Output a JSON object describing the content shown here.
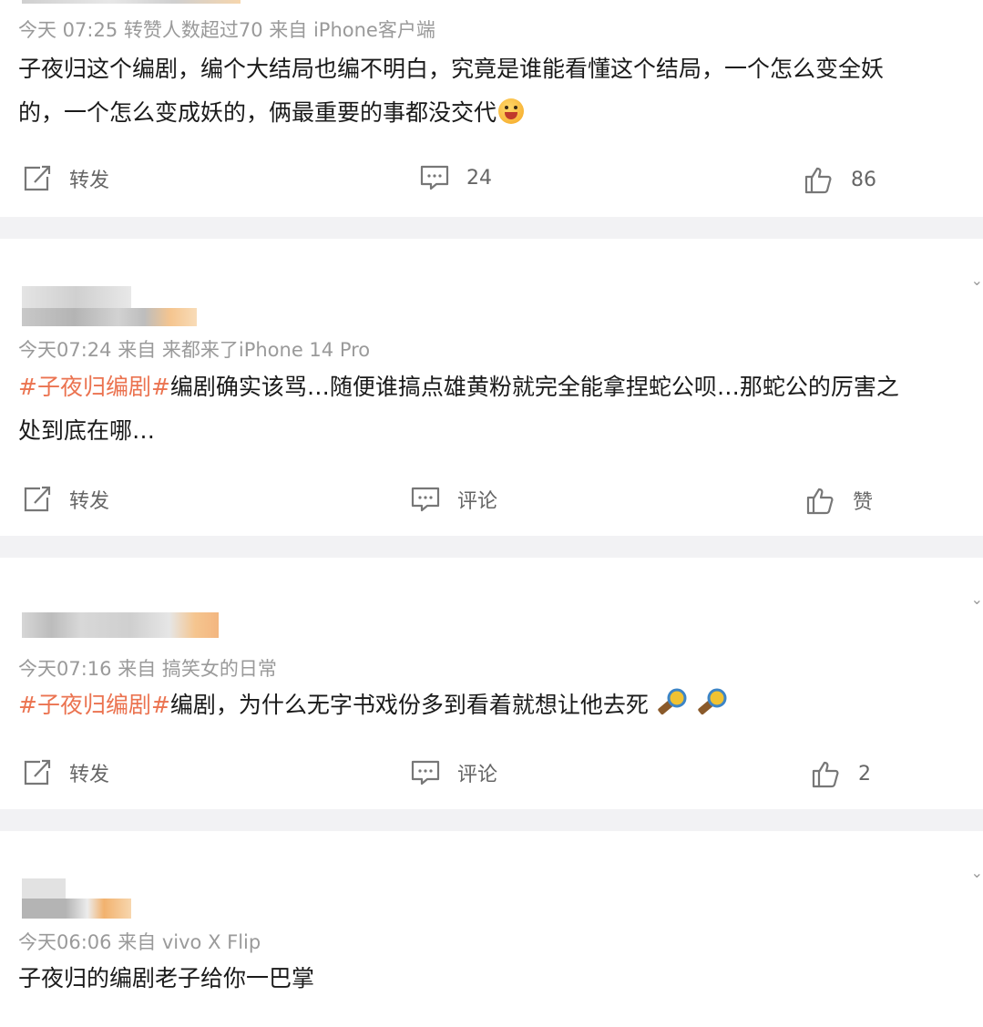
{
  "posts": [
    {
      "meta": "今天 07:25 转赞人数超过70  来自 iPhone客户端",
      "text_line1": "子夜归这个编剧，编个大结局也编不明白，究竟是谁能看懂这个结局，一个怎么变全妖",
      "text_line2": "的，一个怎么变成妖的，俩最重要的事都没交代",
      "repost_label": "转发",
      "comment_label": "24",
      "like_label": "86"
    },
    {
      "meta": "今天07:24  来自 来都来了iPhone 14 Pro",
      "hashtag": "#子夜归编剧#",
      "text_line1": "编剧确实该骂…随便谁搞点雄黄粉就完全能拿捏蛇公呗…那蛇公的厉害之",
      "text_line2": "处到底在哪…",
      "repost_label": "转发",
      "comment_label": "评论",
      "like_label": "赞"
    },
    {
      "meta": "今天07:16  来自 搞笑女的日常",
      "hashtag": "#子夜归编剧#",
      "text_line1": "编剧，为什么无字书戏份多到看着就想让他去死",
      "repost_label": "转发",
      "comment_label": "评论",
      "like_label": "2"
    },
    {
      "meta": "今天06:06  来自 vivo X Flip",
      "text_line1": "子夜归的编剧老子给你一巴掌"
    }
  ],
  "icons": {
    "repost": "repost-icon",
    "comment": "comment-icon",
    "like": "thumbs-up-icon",
    "more": "chevron-down-icon"
  },
  "colors": {
    "hashtag": "#eb7350",
    "meta": "#9a9a9a",
    "background": "#f2f2f4"
  }
}
